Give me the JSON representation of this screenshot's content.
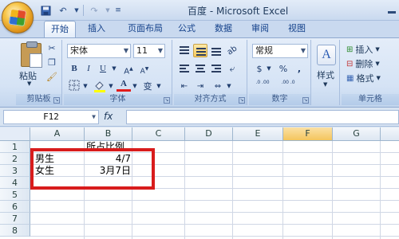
{
  "window": {
    "title": "百度 - Microsoft Excel"
  },
  "tabs": [
    "开始",
    "插入",
    "页面布局",
    "公式",
    "数据",
    "审阅",
    "视图"
  ],
  "ribbon": {
    "clipboard": {
      "paste_label": "粘贴",
      "group_label": "剪贴板"
    },
    "font": {
      "font_name": "宋体",
      "font_size": "11",
      "group_label": "字体",
      "bold": "B",
      "italic": "I",
      "underline": "U",
      "font_color_letter": "A",
      "wen": "变"
    },
    "alignment": {
      "group_label": "对齐方式"
    },
    "number": {
      "format": "常规",
      "percent": "%",
      "comma": ",",
      "group_label": "数字",
      "inc_decimal": ".0 .00",
      "dec_decimal": ".00 .0",
      "currency": "$"
    },
    "styles": {
      "label": "样式"
    },
    "cells": {
      "insert": "插入",
      "delete": "删除",
      "format": "格式",
      "group_label": "单元格"
    }
  },
  "formula_bar": {
    "name_box": "F12",
    "fx": "fx",
    "value": ""
  },
  "grid": {
    "columns": [
      "A",
      "B",
      "C",
      "D",
      "E",
      "F",
      "G"
    ],
    "rows": [
      "1",
      "2",
      "3",
      "4",
      "5",
      "6",
      "7",
      "8"
    ],
    "cells": {
      "B1": "所占比例",
      "A2": "男生",
      "B2": "4/7",
      "A3": "女生",
      "B3": "3月7日"
    },
    "selected_column": "F"
  },
  "colors": {
    "annotation_box": "#d81c1c",
    "selected_header": "#f4c55d"
  }
}
